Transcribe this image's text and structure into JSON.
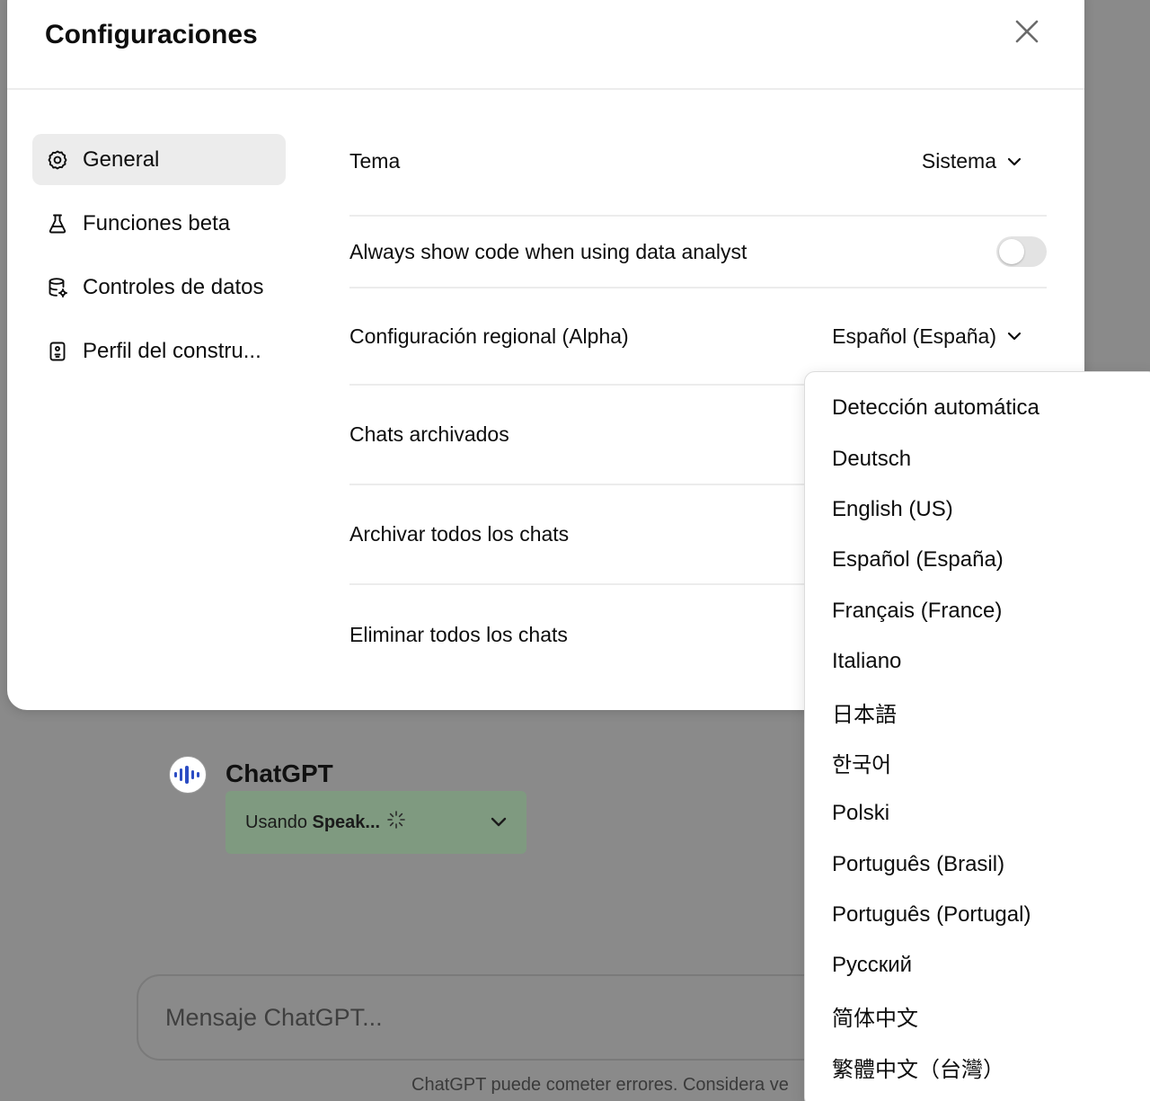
{
  "modal": {
    "title": "Configuraciones"
  },
  "sidebar": {
    "items": [
      {
        "label": "General",
        "icon": "gear-icon",
        "active": true
      },
      {
        "label": "Funciones beta",
        "icon": "flask-icon",
        "active": false
      },
      {
        "label": "Controles de datos",
        "icon": "database-icon",
        "active": false
      },
      {
        "label": "Perfil del constru...",
        "icon": "id-badge-icon",
        "active": false
      }
    ]
  },
  "settings": {
    "theme": {
      "label": "Tema",
      "value": "Sistema"
    },
    "code_toggle": {
      "label": "Always show code when using data analyst",
      "enabled": false
    },
    "locale": {
      "label": "Configuración regional (Alpha)",
      "value": "Español (España)"
    },
    "archived": {
      "label": "Chats archivados"
    },
    "archive_all": {
      "label": "Archivar todos los chats"
    },
    "delete_all": {
      "label": "Eliminar todos los chats"
    }
  },
  "locale_dropdown": {
    "options": [
      "Detección automática",
      "Deutsch",
      "English (US)",
      "Español (España)",
      "Français (France)",
      "Italiano",
      "日本語",
      "한국어",
      "Polski",
      "Português (Brasil)",
      "Português (Portugal)",
      "Русский",
      "简体中文",
      "繁體中文（台灣）"
    ]
  },
  "chat": {
    "assistant_name": "ChatGPT",
    "tool_prefix": "Usando ",
    "tool_name": "Speak...",
    "composer_placeholder": "Mensaje ChatGPT...",
    "footer_note": "ChatGPT puede cometer errores. Considera ve"
  },
  "colors": {
    "overlay": "#8a8a8a",
    "modal_bg": "#ffffff",
    "active_nav": "#ececec",
    "tool_pill": "#7f9a80",
    "avatar_accent": "#2b4cc4"
  }
}
